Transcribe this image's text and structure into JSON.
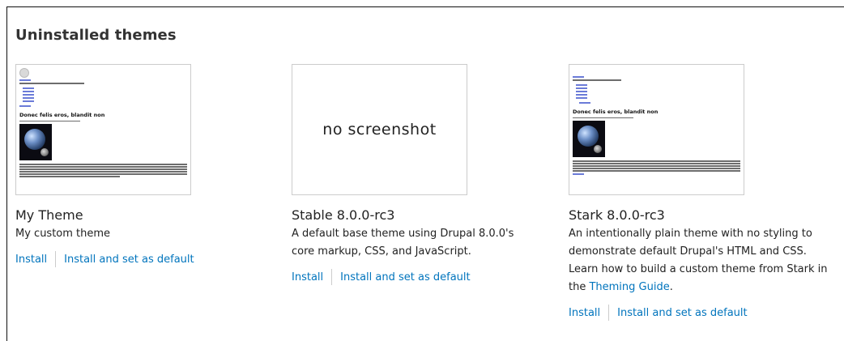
{
  "section": {
    "title": "Uninstalled themes"
  },
  "themes": [
    {
      "name": "My Theme",
      "description": "My custom theme",
      "screenshot": {
        "type": "image",
        "icon": "theme-preview-image",
        "heading": "Donec felis eros, blandit non"
      },
      "actions": {
        "install": "Install",
        "install_default": "Install and set as default"
      }
    },
    {
      "name": "Stable 8.0.0-rc3",
      "description": "A default base theme using Drupal 8.0.0's core markup, CSS, and JavaScript.",
      "screenshot": {
        "type": "placeholder",
        "text": "no screenshot"
      },
      "actions": {
        "install": "Install",
        "install_default": "Install and set as default"
      }
    },
    {
      "name": "Stark 8.0.0-rc3",
      "description_before": "An intentionally plain theme with no styling to demonstrate default Drupal's HTML and CSS. Learn how to build a custom theme from Stark in the ",
      "description_link": "Theming Guide",
      "description_after": ".",
      "screenshot": {
        "type": "image",
        "icon": "theme-preview-image",
        "heading": "Donec felis eros, blandit non"
      },
      "actions": {
        "install": "Install",
        "install_default": "Install and set as default"
      }
    }
  ],
  "colors": {
    "link": "#0074bd",
    "text": "#222222",
    "border": "#cccccc"
  }
}
